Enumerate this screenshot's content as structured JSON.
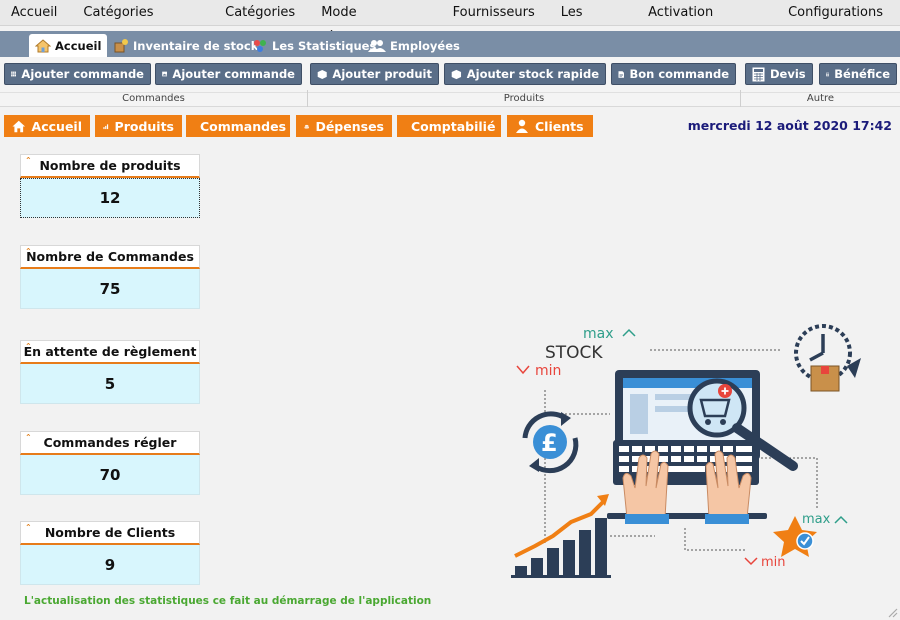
{
  "menu": [
    "Accueil",
    "Catégories parent",
    "Catégories",
    "Mode réglement",
    "Fournisseurs",
    "Les notes",
    "Activation logiciel",
    "Configurations"
  ],
  "tabs": [
    {
      "label": "Accueil",
      "icon": "home-icon",
      "active": true
    },
    {
      "label": "Inventaire de stock",
      "icon": "inventory-icon",
      "active": false
    },
    {
      "label": "Les Statistiques",
      "icon": "statistics-icon",
      "active": false
    },
    {
      "label": "Employées",
      "icon": "employees-icon",
      "active": false
    }
  ],
  "ribbon": {
    "buttons": [
      {
        "label": "Ajouter commande",
        "icon": "grid-icon"
      },
      {
        "label": "Ajouter commande",
        "icon": "image-icon"
      },
      {
        "label": "Ajouter produit",
        "icon": "box-icon"
      },
      {
        "label": "Ajouter stock rapide",
        "icon": "box-icon"
      },
      {
        "label": "Bon commande",
        "icon": "document-icon"
      },
      {
        "label": "Devis",
        "icon": "calculator-icon"
      },
      {
        "label": "Bénéfice",
        "icon": "calculator-icon"
      }
    ],
    "groups": [
      "Commandes",
      "Produits",
      "Autre"
    ]
  },
  "nav": [
    {
      "label": "Accueil",
      "icon": "home-icon"
    },
    {
      "label": "Produits",
      "icon": "chart-icon"
    },
    {
      "label": "Commandes",
      "icon": "delivery-icon"
    },
    {
      "label": "Dépenses",
      "icon": "coins-icon"
    },
    {
      "label": "Comptabilié",
      "icon": "percent-icon"
    },
    {
      "label": "Clients",
      "icon": "user-icon"
    }
  ],
  "datetime": "mercredi 12 août 2020 17:42",
  "stats": [
    {
      "label": "Nombre de produits",
      "value": "12"
    },
    {
      "label": "Nombre de Commandes",
      "value": "75"
    },
    {
      "label": "En attente de règlement",
      "value": "5"
    },
    {
      "label": "Commandes régler",
      "value": "70"
    },
    {
      "label": "Nombre de Clients",
      "value": "9"
    }
  ],
  "footnote": "L'actualisation des statistiques ce fait au démarrage de l'application",
  "illustration": {
    "stock": "STOCK",
    "max": "max",
    "min": "min",
    "currency": "£"
  },
  "colors": {
    "accent": "#f07f14",
    "tabstrip": "#7a8ea6",
    "ribbon_button": "#5a6e88",
    "card_value_bg": "#d8f6fd",
    "datetime": "#1b1b7a",
    "footnote": "#4aa832"
  }
}
